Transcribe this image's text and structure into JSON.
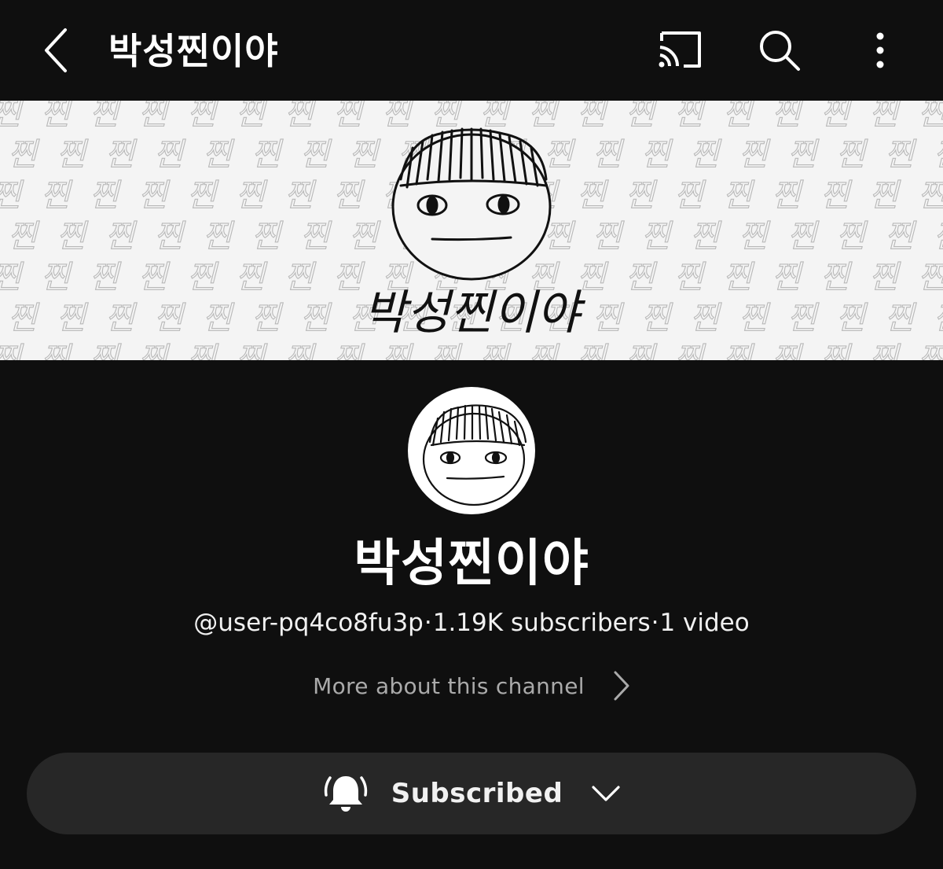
{
  "header": {
    "title": "박성찐이야",
    "back_icon": "chevron-left-icon",
    "cast_icon": "cast-icon",
    "search_icon": "search-icon",
    "more_icon": "more-vertical-icon"
  },
  "banner": {
    "logo_text": "박성찐이야",
    "pattern_text": "찐"
  },
  "channel": {
    "name": "박성찐이야",
    "handle": "@user-pq4co8fu3p",
    "separator": "·",
    "subscribers": "1.19K subscribers",
    "videos": "1 video",
    "more_about_label": "More about this channel"
  },
  "subscribe": {
    "label": "Subscribed",
    "bell_icon": "bell-ringing-icon",
    "chevron_icon": "chevron-down-icon"
  },
  "colors": {
    "background": "#0f0f0f",
    "button_bg": "#272727",
    "text_primary": "#ffffff",
    "text_secondary": "#aaaaaa",
    "banner_bg": "#f4f4f4"
  }
}
